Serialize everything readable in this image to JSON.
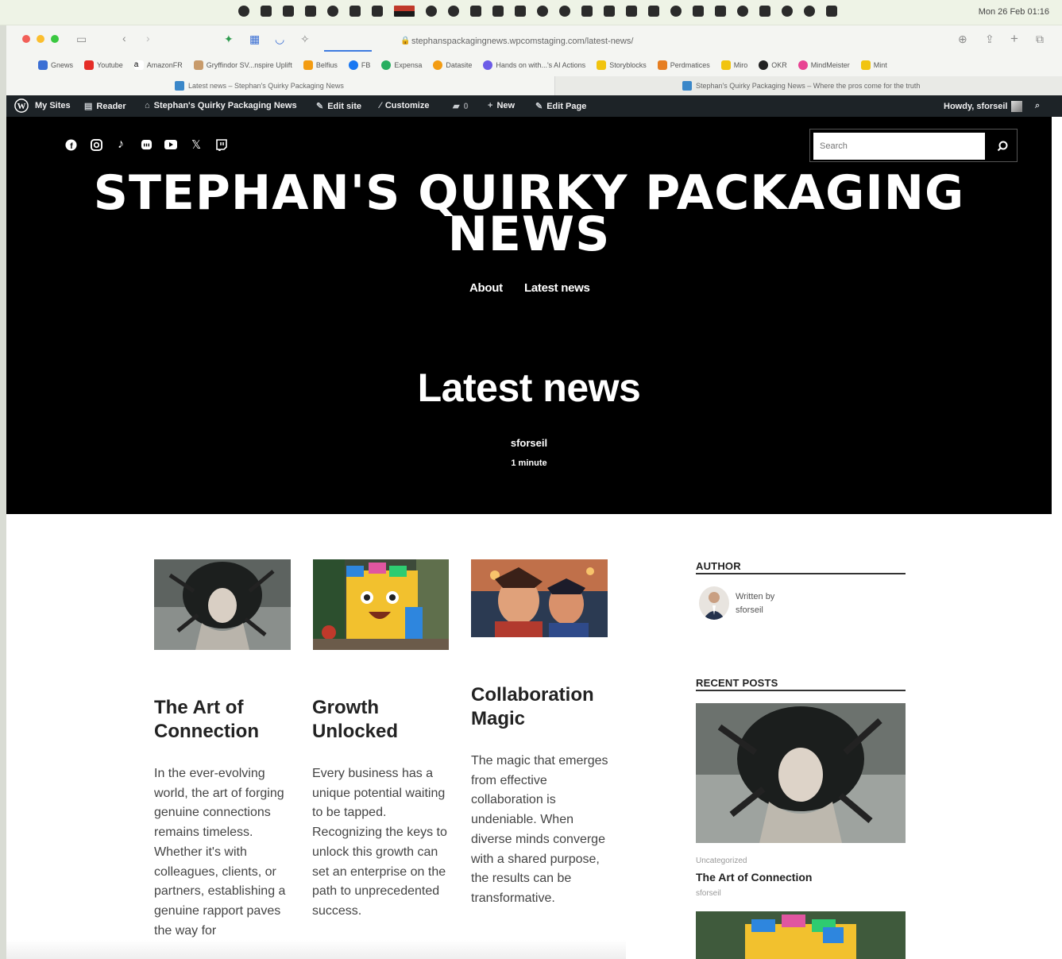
{
  "menubar": {
    "clock": "Mon 26 Feb 01:16"
  },
  "browser": {
    "url": "stephanspackagingnews.wpcomstaging.com/latest-news/",
    "bookmarks": [
      "Gnews",
      "Youtube",
      "AmazonFR",
      "Gryffindor SV...nspire Uplift",
      "Belfius",
      "FB",
      "Expensa",
      "Datasite",
      "Hands on with...'s AI Actions",
      "Storyblocks",
      "Perdmatices",
      "Miro",
      "OKR",
      "MindMeister",
      "Mint"
    ],
    "tabs": [
      "Latest news – Stephan's Quirky Packaging News",
      "Stephan's Quirky Packaging News – Where the pros come for the truth"
    ]
  },
  "adminbar": {
    "my_sites": "My Sites",
    "reader": "Reader",
    "site": "Stephan's Quirky Packaging News",
    "edit_site": "Edit site",
    "customize": "Customize",
    "comments": "0",
    "new": "New",
    "edit_page": "Edit Page",
    "howdy": "Howdy, sforseil"
  },
  "header": {
    "search_placeholder": "Search",
    "site_title": "STEPHAN'S QUIRKY PACKAGING NEWS",
    "nav": [
      "About",
      "Latest news"
    ],
    "page_title": "Latest news",
    "author": "sforseil",
    "read_time": "1 minute"
  },
  "posts": [
    {
      "title": "The Art of Connection",
      "excerpt": "In the ever-evolving world, the art of forging genuine connections remains timeless. Whether it's with colleagues, clients, or partners, establishing a genuine rapport paves the way for"
    },
    {
      "title": "Growth Unlocked",
      "excerpt": "Every business has a unique potential waiting to be tapped. Recognizing the keys to unlock this growth can set an enterprise on the path to unprecedented success."
    },
    {
      "title": "Collaboration Magic",
      "excerpt": "The magic that emerges from effective collaboration is undeniable. When diverse minds converge with a shared purpose, the results can be transformative."
    }
  ],
  "sidebar": {
    "author_heading": "AUTHOR",
    "written_by": "Written by",
    "author": "sforseil",
    "recent_heading": "RECENT POSTS",
    "recent": [
      {
        "category": "Uncategorized",
        "title": "The Art of Connection",
        "author": "sforseil"
      }
    ]
  }
}
